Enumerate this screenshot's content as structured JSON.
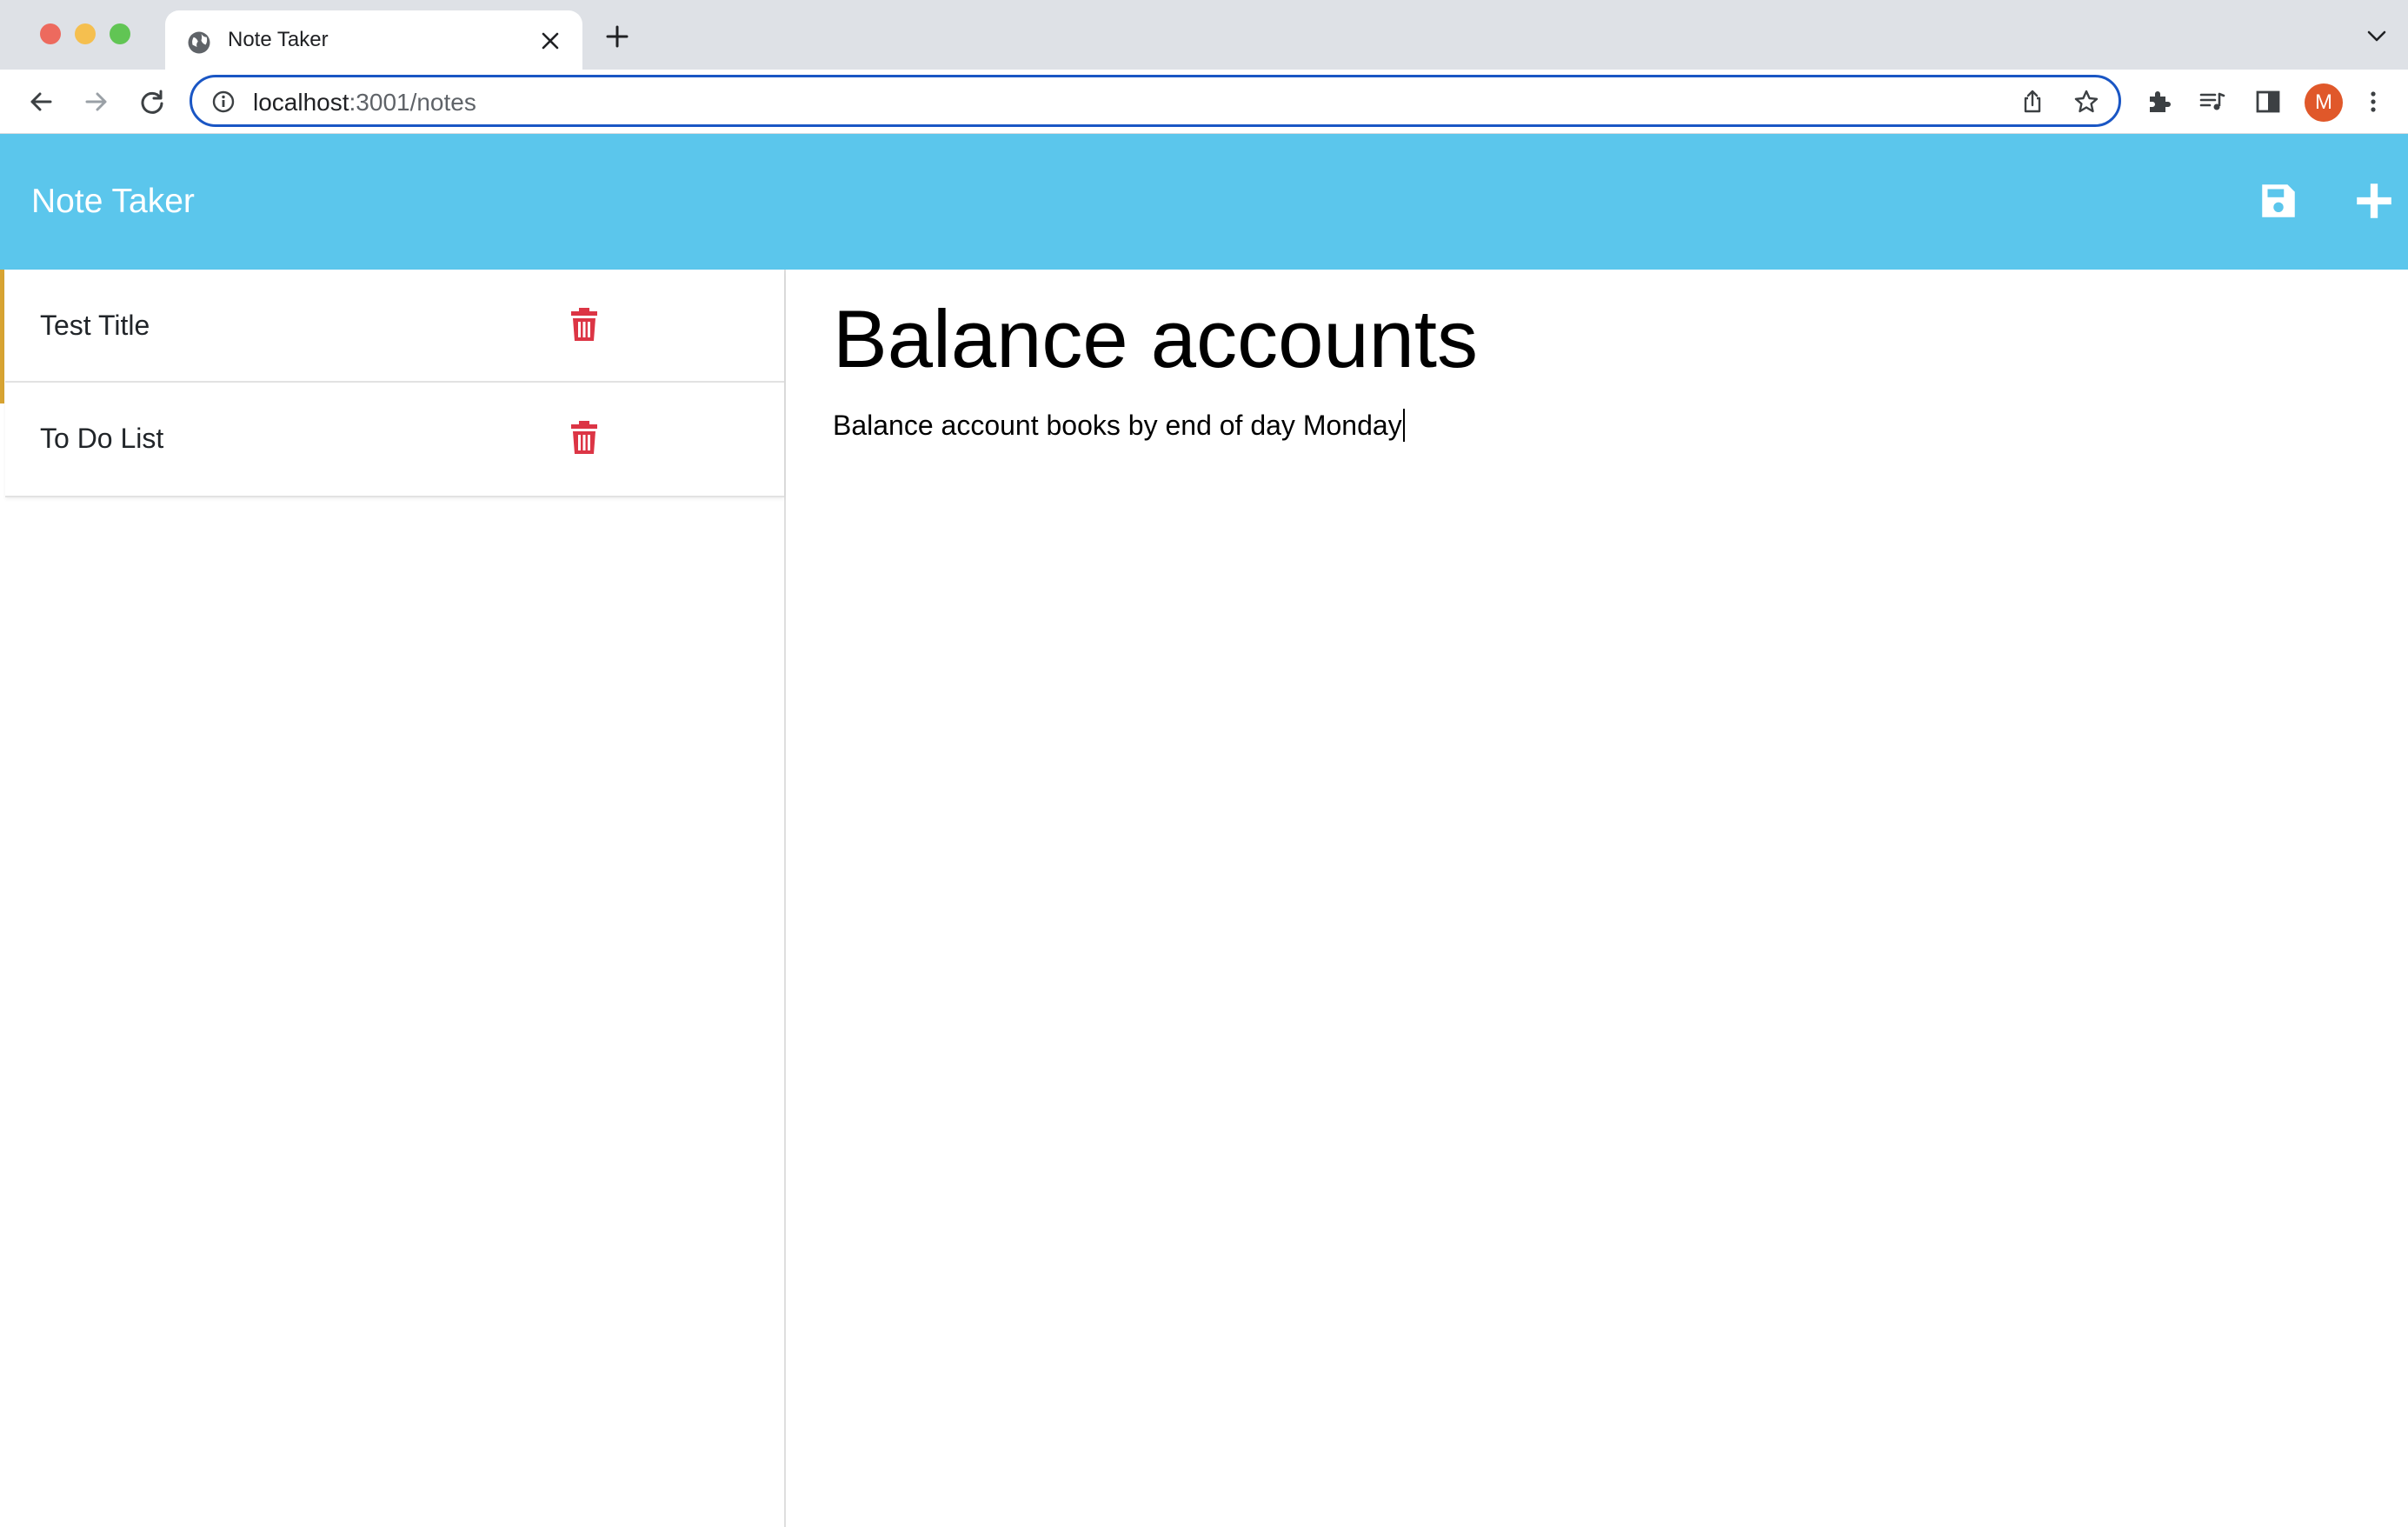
{
  "browser": {
    "tab": {
      "title": "Note Taker"
    },
    "address": {
      "host": "localhost",
      "path": ":3001/notes"
    },
    "profile_initial": "M"
  },
  "app": {
    "brand": "Note Taker",
    "accent_color": "#5bc6ec",
    "delete_color": "#dc3545"
  },
  "notes": [
    {
      "title": "Test Title"
    },
    {
      "title": "To Do List"
    }
  ],
  "active_note": {
    "title": "Balance accounts",
    "text": "Balance account books by end of day Monday"
  }
}
